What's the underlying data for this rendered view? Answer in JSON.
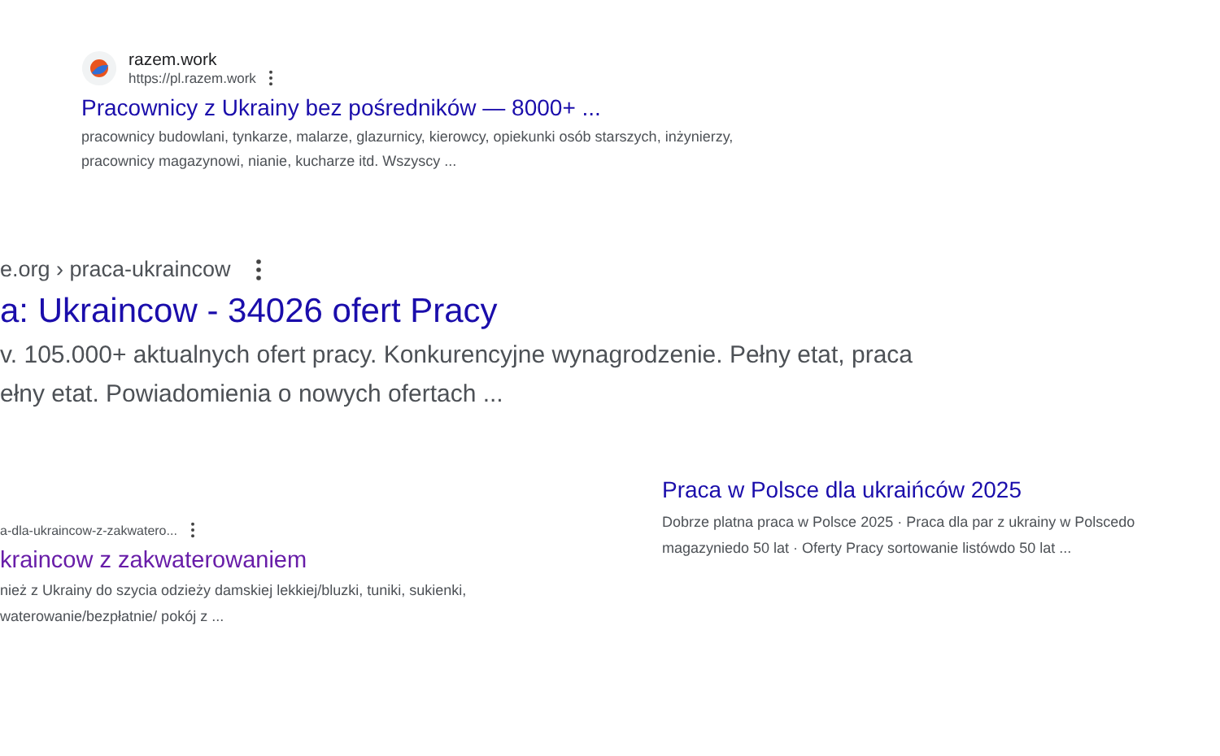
{
  "results": [
    {
      "site_name": "razem.work",
      "url": "https://pl.razem.work",
      "title": "Pracownicy z Ukrainy bez pośredników — 8000+ ...",
      "visited": false,
      "snippet": [
        "pracownicy budowlani, tynkarze, malarze, glazurnicy, kierowcy, opiekunki osób starszych, inżynierzy,",
        "pracownicy magazynowi, nianie, kucharze itd. Wszyscy ..."
      ]
    },
    {
      "url": "e.org › praca-ukraincow",
      "title": "a: Ukraincow - 34026 ofert Pracy",
      "visited": false,
      "snippet": [
        "v. 105.000+ aktualnych ofert pracy. Konkurencyjne wynagrodzenie. Pełny etat, praca",
        "ełny etat. Powiadomienia o nowych ofertach ..."
      ]
    },
    {
      "url": "a-dla-ukraincow-z-zakwatero...",
      "title": "kraincow z zakwaterowaniem",
      "visited": true,
      "snippet": [
        "nież z Ukrainy do szycia odzieży damskiej lekkiej/bluzki, tuniki, sukienki,",
        "waterowanie/bezpłatnie/ pokój z ..."
      ]
    },
    {
      "title": "Praca w Polsce dla ukraińców 2025",
      "visited": false,
      "snippet": [
        "Dobrze platna praca w Polsce 2025 · Praca dla par z ukrainy w Polscedo",
        "magazyniedo 50 lat · Oferty Pracy sortowanie listówdo 50 lat ..."
      ]
    }
  ]
}
